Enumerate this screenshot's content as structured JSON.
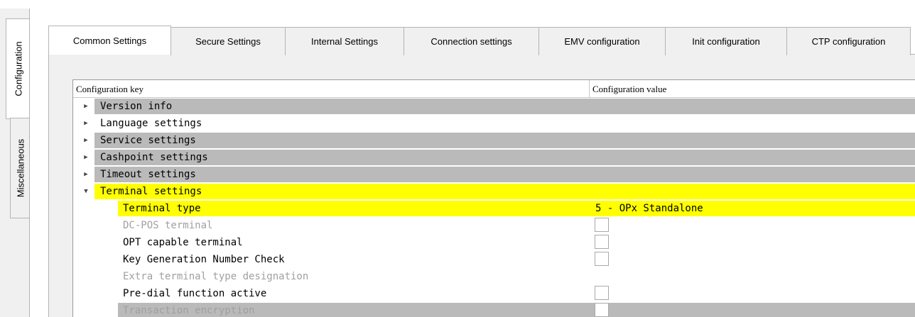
{
  "side_tabs": [
    {
      "label": "Configuration",
      "active": true
    },
    {
      "label": "Miscellaneous",
      "active": false
    }
  ],
  "tabs": [
    {
      "label": "Common Settings",
      "active": true
    },
    {
      "label": "Secure Settings",
      "active": false
    },
    {
      "label": "Internal Settings",
      "active": false
    },
    {
      "label": "Connection settings",
      "active": false
    },
    {
      "label": "EMV configuration",
      "active": false
    },
    {
      "label": "Init configuration",
      "active": false
    },
    {
      "label": "CTP configuration",
      "active": false
    }
  ],
  "tree": {
    "columns": {
      "key": "Configuration key",
      "value": "Configuration value"
    },
    "rows": [
      {
        "key": "Version info",
        "level": 0,
        "expander": "collapsed",
        "style": "gray"
      },
      {
        "key": "Language settings",
        "level": 0,
        "expander": "collapsed",
        "style": "white"
      },
      {
        "key": "Service settings",
        "level": 0,
        "expander": "collapsed",
        "style": "gray"
      },
      {
        "key": "Cashpoint settings",
        "level": 0,
        "expander": "collapsed",
        "style": "gray"
      },
      {
        "key": "Timeout settings",
        "level": 0,
        "expander": "collapsed",
        "style": "gray"
      },
      {
        "key": "Terminal settings",
        "level": 0,
        "expander": "expanded",
        "style": "yellow"
      },
      {
        "key": "Terminal type",
        "level": 1,
        "style": "yellow",
        "value": "5 - OPx Standalone"
      },
      {
        "key": "DC-POS terminal",
        "level": 1,
        "style": "white",
        "disabled": true,
        "checkbox": true
      },
      {
        "key": "OPT capable terminal",
        "level": 1,
        "style": "white",
        "checkbox": true
      },
      {
        "key": "Key Generation Number Check",
        "level": 1,
        "style": "white",
        "checkbox": true
      },
      {
        "key": "Extra terminal type designation",
        "level": 1,
        "style": "white",
        "disabled": true
      },
      {
        "key": "Pre-dial function active",
        "level": 1,
        "style": "white",
        "checkbox": true
      },
      {
        "key": "Transaction encryption",
        "level": 1,
        "style": "gray",
        "disabled": true,
        "checkbox": true
      }
    ]
  },
  "colors": {
    "highlight": "#ffff00",
    "group_gray": "#bababa"
  },
  "icons": {
    "collapsed": "triangle-right-icon",
    "expanded": "triangle-down-icon"
  }
}
